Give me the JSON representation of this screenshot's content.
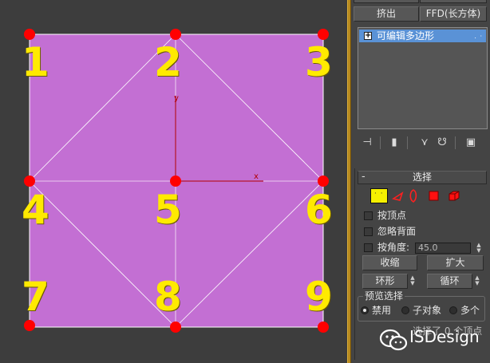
{
  "panel": {
    "buttons": {
      "extrude": "挤出",
      "ffd": "FFD(长方体)"
    },
    "modifier_stack": {
      "item_label": "可编辑多边形",
      "item_dots": ". ·"
    },
    "selection_rollout": {
      "title": "选择",
      "by_vertex": "按顶点",
      "ignore_backfacing": "忽略背面",
      "by_angle": "按角度:",
      "angle_value": "45.0",
      "shrink": "收缩",
      "grow": "扩大",
      "ring": "环形",
      "loop": "循环",
      "preview": {
        "title": "预览选择",
        "off": "禁用",
        "subobject": "子对象",
        "multi": "多个"
      },
      "status": "选择了 0 个顶点"
    }
  },
  "viewport": {
    "labels": [
      "1",
      "2",
      "3",
      "4",
      "5",
      "6",
      "7",
      "8",
      "9"
    ],
    "axis_x": "x",
    "axis_y": "y",
    "plane_color": "#c36fd3",
    "vertex_color": "#ff0000",
    "label_color": "#ffea00"
  },
  "watermark": {
    "text": "ISDesign"
  }
}
